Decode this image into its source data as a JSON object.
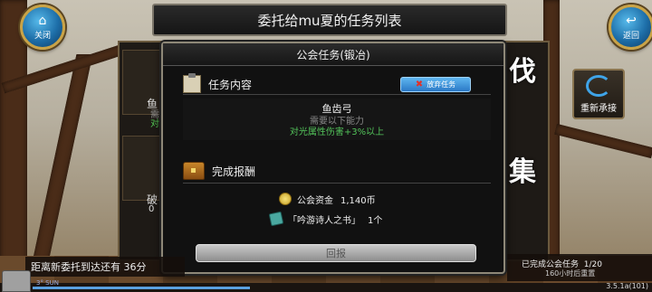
{
  "header": {
    "title": "委托给mu夏的任务列表"
  },
  "nav": {
    "close_label": "关闭",
    "back_label": "返回"
  },
  "side": {
    "reaccept_label": "重新承接",
    "big_char_1": "伐",
    "big_char_2": "集"
  },
  "background_list": {
    "items": [
      {
        "name": "鱼",
        "sub1": "需",
        "sub2": "对"
      },
      {
        "name": "破",
        "sub1": "0"
      }
    ]
  },
  "dialog": {
    "title": "公会任务(锻冶)",
    "task_section_label": "任务内容",
    "abandon_label": "放弃任务",
    "task": {
      "name": "鱼齿弓",
      "requirement": "需要以下能力",
      "attribute": "对光属性伤害+3%以上"
    },
    "reward_section_label": "完成报酬",
    "rewards": [
      {
        "label": "公会资金",
        "value": "1,140币"
      },
      {
        "label": "「吟游诗人之书」",
        "value": "1个"
      }
    ],
    "receive_label": "回报"
  },
  "footer": {
    "new_request_text": "距离新委托到达还有 36分",
    "completed_label": "已完成公会任务",
    "completed_count": "1/20",
    "reset_text": "160小时后重置",
    "version": "3.5.1a(101)",
    "avatar_text": "3° SUN"
  },
  "colors": {
    "accent_blue": "#2a79c6",
    "green_text": "#53c45a",
    "gold_border": "#c9a347"
  }
}
